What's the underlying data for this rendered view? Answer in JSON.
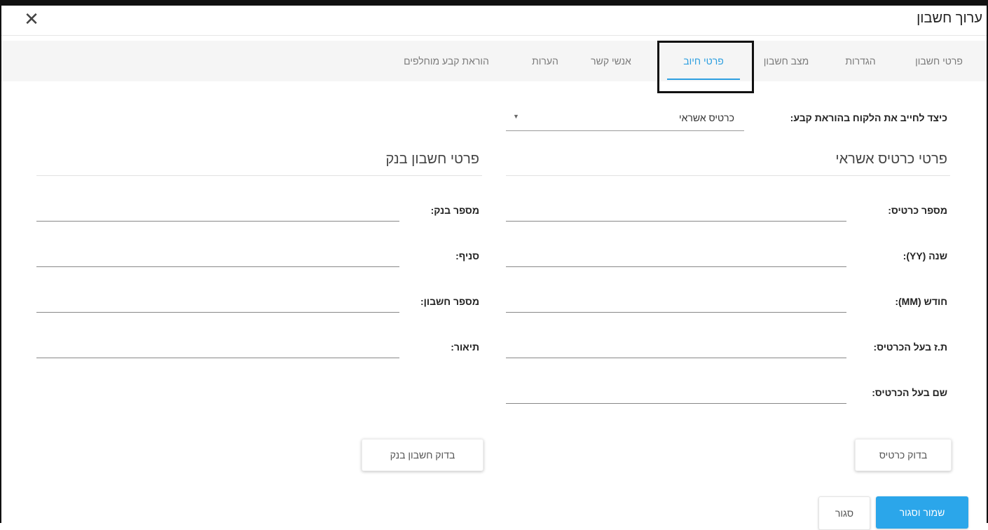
{
  "dialog": {
    "title": "ערוך חשבון",
    "close_symbol": "✕"
  },
  "tabs": [
    {
      "label": "פרטי חשבון",
      "active": false
    },
    {
      "label": "הגדרות",
      "active": false
    },
    {
      "label": "מצב חשבון",
      "active": false
    },
    {
      "label": "פרטי חיוב",
      "active": true
    },
    {
      "label": "אנשי קשר",
      "active": false
    },
    {
      "label": "הערות",
      "active": false
    },
    {
      "label": "הוראת קבע מוחלפים",
      "active": false
    }
  ],
  "charge_method": {
    "label": "כיצד לחייב את הלקוח בהוראת קבע:",
    "selected": "כרטיס אשראי",
    "arrow": "▼"
  },
  "credit_card": {
    "title": "פרטי כרטיס אשראי",
    "fields": [
      {
        "label": "מספר כרטיס:",
        "value": ""
      },
      {
        "label": "שנה (YY):",
        "value": ""
      },
      {
        "label": "חודש (MM):",
        "value": ""
      },
      {
        "label": "ת.ז בעל הכרטיס:",
        "value": ""
      },
      {
        "label": "שם בעל הכרטיס:",
        "value": ""
      }
    ],
    "check_button": "בדוק כרטיס"
  },
  "bank_account": {
    "title": "פרטי חשבון בנק",
    "fields": [
      {
        "label": "מספר בנק:",
        "value": ""
      },
      {
        "label": "סניף:",
        "value": ""
      },
      {
        "label": "מספר חשבון:",
        "value": ""
      },
      {
        "label": "תיאור:",
        "value": ""
      }
    ],
    "check_button": "בדוק חשבון בנק"
  },
  "footer": {
    "close_label": "סגור",
    "save_label": "שמור וסגור"
  },
  "colors": {
    "accent": "#2d9fe0",
    "save_button": "#2ba6ea",
    "tab_bar_bg": "#f5f5f5"
  }
}
